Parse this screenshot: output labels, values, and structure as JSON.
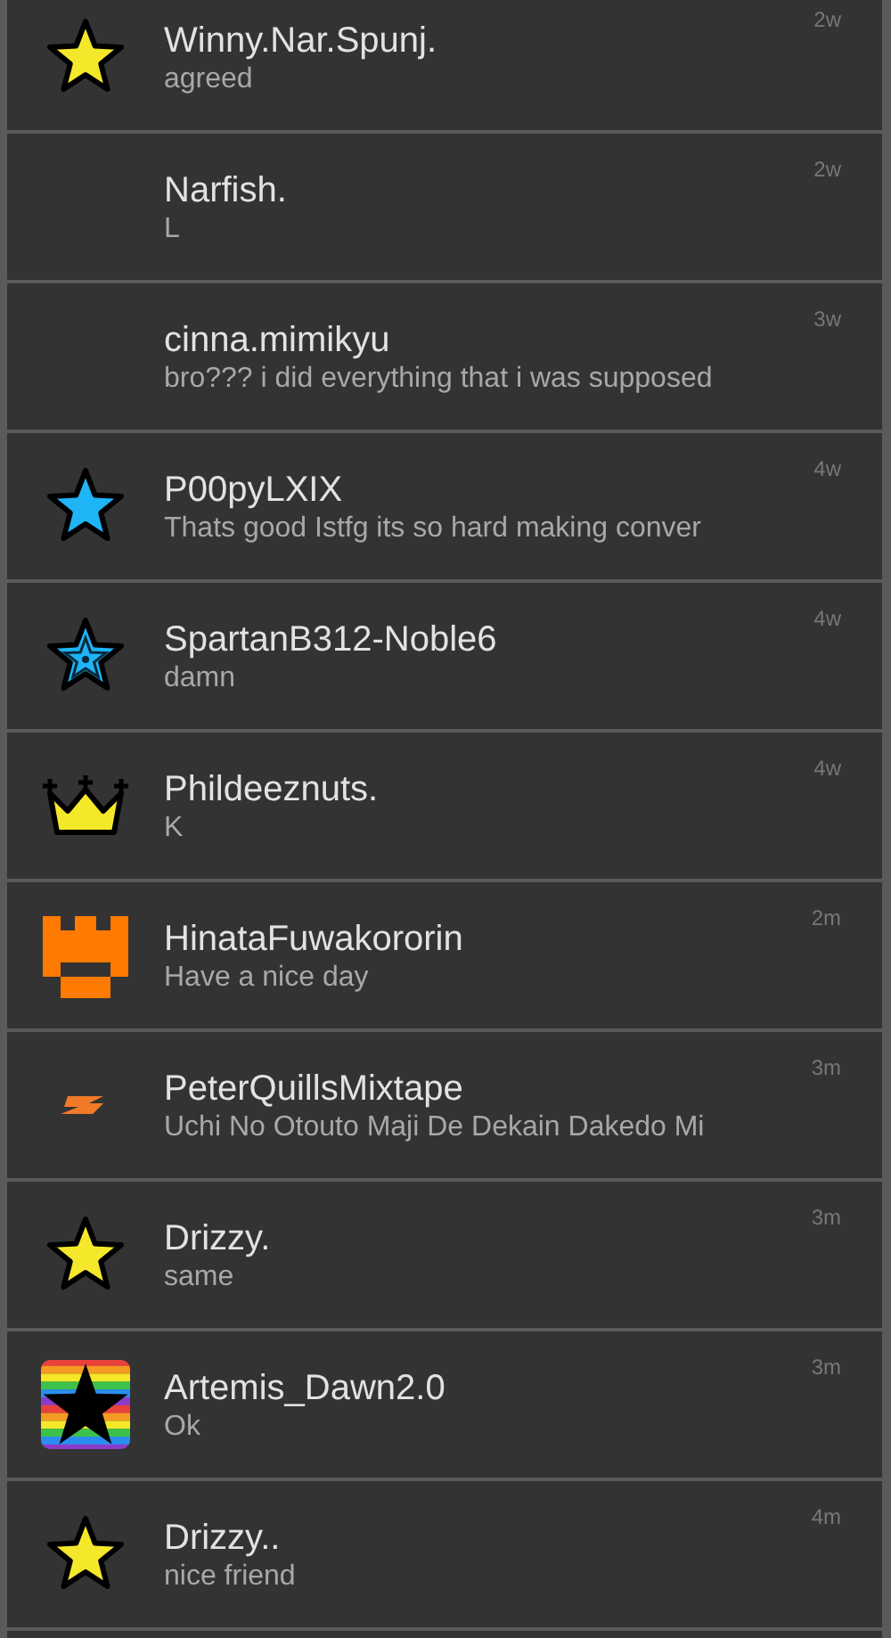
{
  "conversations": [
    {
      "name": "Winny.Nar.Spunj.",
      "message": "agreed",
      "time": "2w",
      "badge": {
        "kind": "star",
        "color": "#f5e82a"
      }
    },
    {
      "name": "Narfish.",
      "message": "L",
      "time": "2w"
    },
    {
      "name": "cinna.mimikyu",
      "message": "bro??? i did everything that i was supposed",
      "time": "3w"
    },
    {
      "name": "P00pyLXIX",
      "message": "Thats good Istfg its so hard making conver",
      "time": "4w",
      "badge": {
        "kind": "star",
        "color": "#1eb4f5"
      }
    },
    {
      "name": "SpartanB312-Noble6",
      "message": "damn",
      "time": "4w",
      "badge": {
        "kind": "ring-star",
        "color": "#1eb4f5"
      }
    },
    {
      "name": "Phildeeznuts.",
      "message": "K",
      "time": "4w",
      "badge": {
        "kind": "crown",
        "color": "#f5e82a"
      }
    },
    {
      "name": "HinataFuwakororin",
      "message": "Have a nice day",
      "time": "2m",
      "badge": {
        "kind": "castle",
        "color": "#ff7a00"
      }
    },
    {
      "name": "PeterQuillsMixtape",
      "message": "Uchi No Otouto Maji De Dekain Dakedo Mi",
      "time": "3m",
      "badge": {
        "kind": "bolt",
        "color": "#f07a28"
      }
    },
    {
      "name": "Drizzy.",
      "message": "same",
      "time": "3m",
      "badge": {
        "kind": "star",
        "color": "#f5e82a"
      }
    },
    {
      "name": "Artemis_Dawn2.0",
      "message": "Ok",
      "time": "3m",
      "badge": {
        "kind": "rainbow-star",
        "color": "#000000"
      }
    },
    {
      "name": "Drizzy..",
      "message": "nice friend",
      "time": "4m",
      "badge": {
        "kind": "star",
        "color": "#f5e82a"
      }
    }
  ]
}
